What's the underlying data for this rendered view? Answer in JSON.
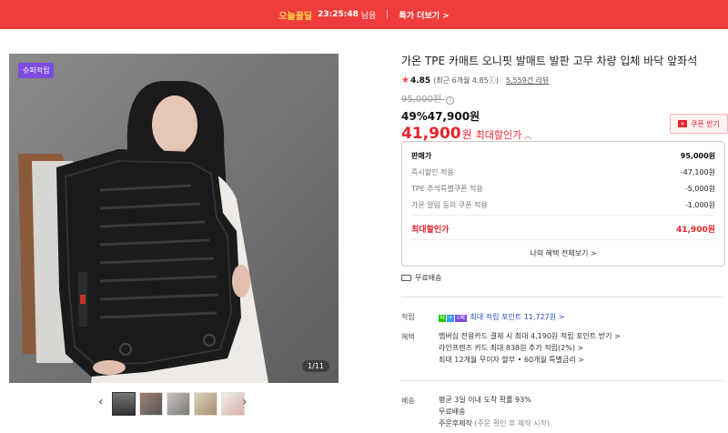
{
  "banner": {
    "deal_label": "오늘꿀딜",
    "timer": "23:25:48",
    "timer_suffix": "남음",
    "more_label": "특가 더보기 >"
  },
  "gallery": {
    "badge": "슈퍼적립",
    "counter": "1/11",
    "prev_icon": "‹",
    "next_icon": "›"
  },
  "product": {
    "title": "가온 TPE 카매트 오니핏 발매트 발판 고무 차량 입체 바닥 앞좌석",
    "rating": "4.85",
    "rating_recent": "(최근 6개월 4.85ⓘ)",
    "review_count": "5,559건 리뷰",
    "original_price": "95,000원",
    "discount_pct": "49%",
    "discount_price": "47,900원",
    "final_price": "41,900",
    "final_won": "원",
    "final_label": "최대할인가",
    "coupon_label": "쿠폰 받기"
  },
  "pricebox": {
    "rows": [
      {
        "label": "판매가",
        "value": "95,000원"
      },
      {
        "label": "즉시할인 적용",
        "value": "-47,100원"
      },
      {
        "label": "TPE 추석특별쿠폰 적용",
        "value": "-5,000원"
      },
      {
        "label": "가온 알림 동의 쿠폰 적용",
        "value": "-1,000원"
      }
    ],
    "total_label": "최대할인가",
    "total_value": "41,900원",
    "more": "나의 혜택 전체보기 >"
  },
  "shipping": {
    "label": "무료배송"
  },
  "points": {
    "label": "적립",
    "badge_n": "N",
    "badge_plus": "+",
    "badge_c": "c페",
    "text": "최대 적립 포인트 11,727원 >"
  },
  "benefits": {
    "label": "혜택",
    "lines": [
      "멤버십 전용카드 결제 시 최대 4,190원 적립 포인트 받기 >",
      "라인프렌즈 카드 최대 838원 추가 적립(2%) >",
      "최대 12개월 무이자 할부 • 60개월 특별금리 >"
    ]
  },
  "delivery": {
    "label": "배송",
    "line1": "평균 3일 이내 도착 확률 93%",
    "line2": "무료배송",
    "line3": "주문후제작",
    "line3_note": "(주문 확인 후 제작 시작)"
  }
}
